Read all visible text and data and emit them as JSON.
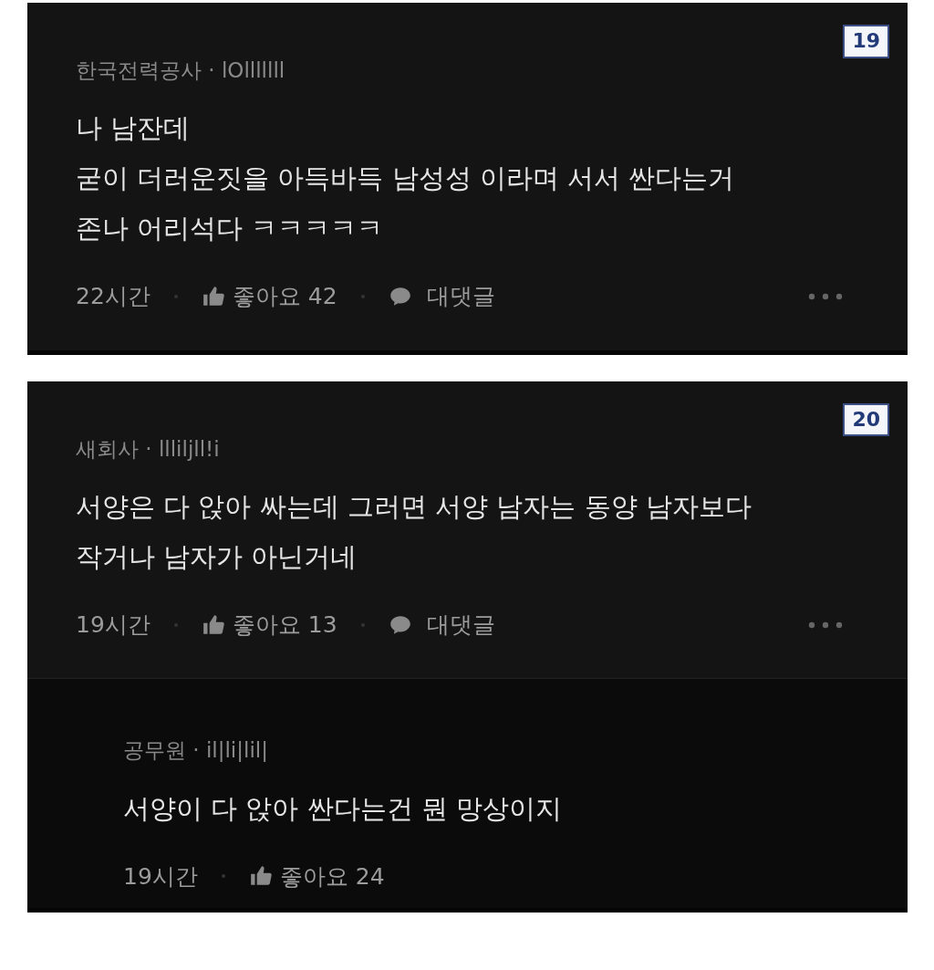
{
  "panels": [
    {
      "number": "19",
      "comments": [
        {
          "kind": "comment",
          "author": "한국전력공사 · lOlllllll",
          "body": "나 남잔데\n굳이 더러운짓을 아득바득 남성성 이라며 서서 싼다는거\n존나 어리석다 ㅋㅋㅋㅋㅋ",
          "time": "22시간",
          "likes": "좋아요 42",
          "reply_label": "대댓글"
        }
      ]
    },
    {
      "number": "20",
      "comments": [
        {
          "kind": "comment",
          "author": "새회사 · llliljll!i",
          "body": "서양은 다 앉아 싸는데 그러면 서양 남자는 동양 남자보다\n작거나 남자가 아닌거네",
          "time": "19시간",
          "likes": "좋아요 13",
          "reply_label": "대댓글"
        },
        {
          "kind": "reply",
          "author": "공무원 · il|li|lil|",
          "body": "서양이 다 앉아 싼다는건 뭔 망상이지",
          "time": "19시간",
          "likes": "좋아요 24"
        }
      ]
    }
  ]
}
